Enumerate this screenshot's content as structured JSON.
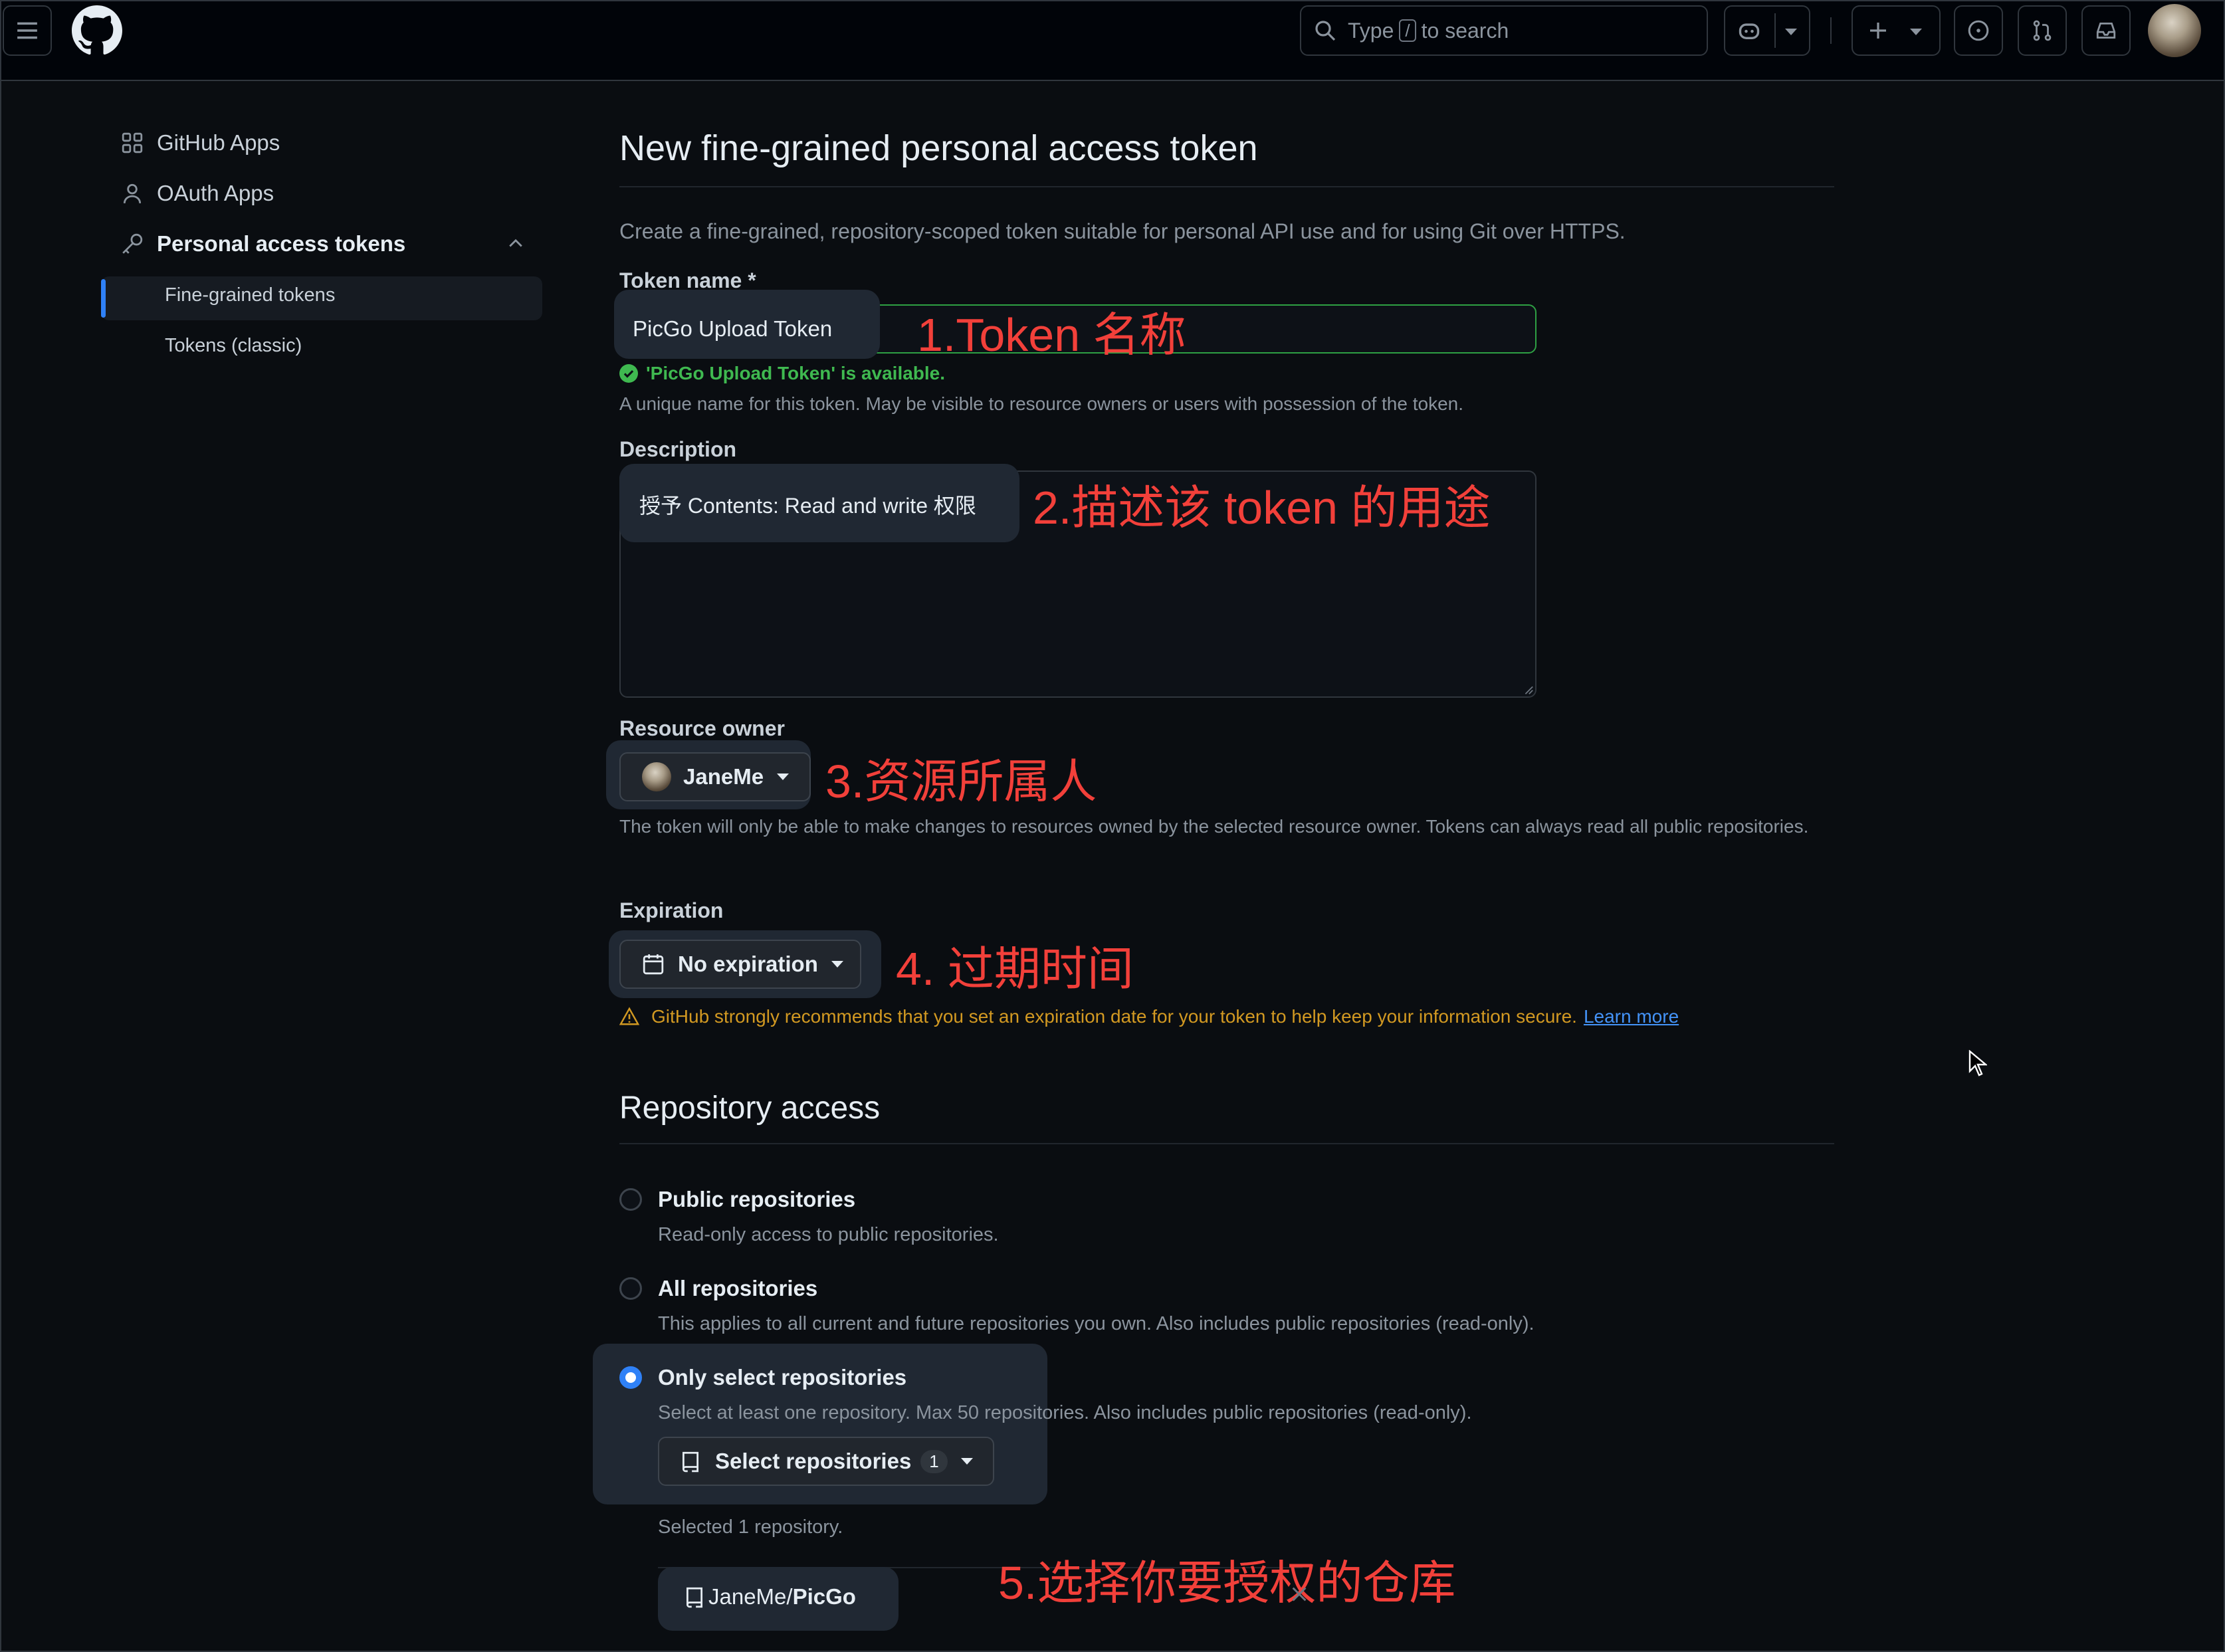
{
  "header": {
    "search_prefix": "Type",
    "search_key": "/",
    "search_suffix": "to search"
  },
  "sidebar": {
    "items": [
      {
        "label": "GitHub Apps"
      },
      {
        "label": "OAuth Apps"
      },
      {
        "label": "Personal access tokens"
      }
    ],
    "sub_items": [
      {
        "label": "Fine-grained tokens"
      },
      {
        "label": "Tokens (classic)"
      }
    ]
  },
  "main": {
    "title": "New fine-grained personal access token",
    "intro": "Create a fine-grained, repository-scoped token suitable for personal API use and for using Git over HTTPS.",
    "token_name": {
      "label": "Token name *",
      "value": "PicGo Upload Token",
      "available_msg": "'PicGo Upload Token' is available.",
      "help": "A unique name for this token. May be visible to resource owners or users with possession of the token."
    },
    "description": {
      "label": "Description",
      "value": "授予 Contents: Read and write 权限"
    },
    "resource_owner": {
      "label": "Resource owner",
      "value": "JaneMe",
      "help": "The token will only be able to make changes to resources owned by the selected resource owner. Tokens can always read all public repositories."
    },
    "expiration": {
      "label": "Expiration",
      "value": "No expiration",
      "warning": "GitHub strongly recommends that you set an expiration date for your token to help keep your information secure.",
      "learn_more": "Learn more"
    },
    "repo_access": {
      "title": "Repository access",
      "options": [
        {
          "title": "Public repositories",
          "desc": "Read-only access to public repositories."
        },
        {
          "title": "All repositories",
          "desc": "This applies to all current and future repositories you own. Also includes public repositories (read-only)."
        },
        {
          "title": "Only select repositories",
          "desc": "Select at least one repository. Max 50 repositories. Also includes public repositories (read-only)."
        }
      ],
      "select_button": "Select repositories",
      "select_count": "1",
      "selected_note": "Selected 1 repository.",
      "selected_repo_owner": "JaneMe/",
      "selected_repo_name": "PicGo"
    }
  },
  "annotations": {
    "a1": "1.Token 名称",
    "a2": "2.描述该 token 的用途",
    "a3": "3.资源所属人",
    "a4": "4. 过期时间",
    "a5": "5.选择你要授权的仓库"
  },
  "colors": {
    "accent": "#2f81f7",
    "success": "#3fb950",
    "warning": "#d29922",
    "annotation": "#f2403a"
  }
}
